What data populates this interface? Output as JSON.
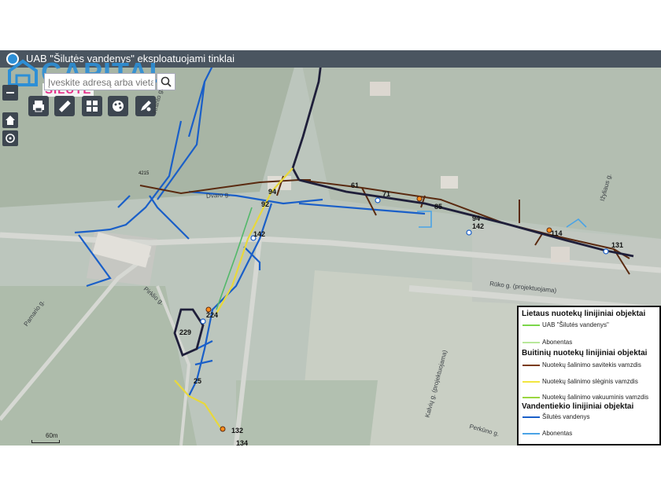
{
  "app": {
    "title": "UAB \"Šilutės vandenys\" eksploatuojami tinklai",
    "logo_text": "CAPITAL",
    "logo_sub": "ŠILUTĖ"
  },
  "search": {
    "placeholder": "Įveskite adresą arba vietą"
  },
  "toolbar": {
    "zoom_out_label": "−",
    "tools": [
      {
        "name": "print-tool",
        "icon": "printer-icon",
        "glyph": "🖶"
      },
      {
        "name": "measure-tool",
        "icon": "ruler-icon",
        "glyph": "✎"
      },
      {
        "name": "basemap-tool",
        "icon": "grid-icon",
        "glyph": "▦"
      },
      {
        "name": "layers-tool",
        "icon": "palette-icon",
        "glyph": "◉"
      },
      {
        "name": "draw-tool",
        "icon": "pencil-icon",
        "glyph": "✐"
      }
    ]
  },
  "map": {
    "labels": [
      "94",
      "61",
      "71",
      "85",
      "94",
      "142",
      "114",
      "131",
      "92",
      "142",
      "224",
      "229",
      "25",
      "132",
      "134",
      "4215"
    ],
    "streets": [
      "Dvaro g.",
      "Rūko g. (projektuojama)",
      "Pamario g.",
      "Perkūno g.",
      "Kalvių g. (projektuojama)",
      "Pirklio g.",
      "Ižyliaus g.",
      "Kranto g."
    ],
    "scale": "60m"
  },
  "legend": {
    "sections": [
      {
        "title": "Lietaus nuotekų linijiniai objektai",
        "items": [
          {
            "label": "UAB \"Šilutės vandenys\"",
            "color": "#7bd64a"
          },
          {
            "label": "Abonentas",
            "color": "#b8e89a"
          }
        ]
      },
      {
        "title": "Buitinių nuotekų linijiniai objektai",
        "items": [
          {
            "label": "Nuotekų šalinimo savitekis vamzdis",
            "color": "#7a3b12"
          },
          {
            "label": "Nuotekų šalinimo slėginis vamzdis",
            "color": "#f2e640"
          },
          {
            "label": "Nuotekų šalinimo vakuuminis vamzdis",
            "color": "#9bd640"
          }
        ]
      },
      {
        "title": "Vandentiekio linijiniai objektai",
        "items": [
          {
            "label": "Šilutės vandenys",
            "color": "#1a5fc8"
          },
          {
            "label": "Abonentas",
            "color": "#4aa3e6"
          }
        ]
      }
    ]
  }
}
